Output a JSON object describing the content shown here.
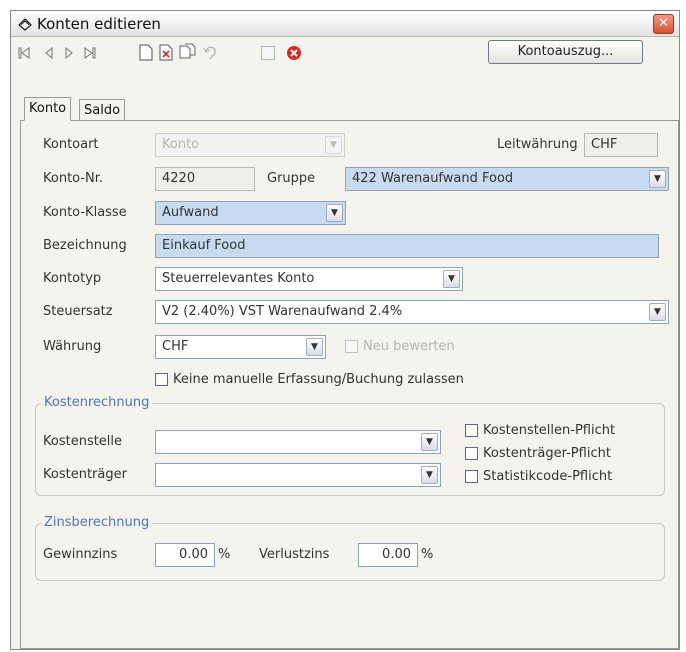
{
  "window": {
    "title": "Konten editieren",
    "close_glyph": "✕"
  },
  "toolbar": {
    "icons": [
      "first-record-icon",
      "previous-record-icon",
      "next-record-icon",
      "last-record-icon",
      "new-document-icon",
      "delete-document-icon",
      "copy-document-icon",
      "undo-icon",
      "checkbox-icon",
      "cancel-icon"
    ],
    "kontoauszug_label": "Kontoauszug..."
  },
  "tabs": [
    {
      "label": "Konto",
      "active": true
    },
    {
      "label": "Saldo",
      "active": false
    }
  ],
  "form": {
    "kontoart": {
      "label": "Kontoart",
      "value": "Konto"
    },
    "leitwaehrung": {
      "label": "Leitwährung",
      "value": "CHF"
    },
    "konto_nr": {
      "label": "Konto-Nr.",
      "value": "4220"
    },
    "gruppe": {
      "label": "Gruppe",
      "value": "422 Warenaufwand Food"
    },
    "konto_klasse": {
      "label": "Konto-Klasse",
      "value": "Aufwand"
    },
    "bezeichnung": {
      "label": "Bezeichnung",
      "value": "Einkauf Food"
    },
    "kontotyp": {
      "label": "Kontotyp",
      "value": "Steuerrelevantes Konto"
    },
    "steuersatz": {
      "label": "Steuersatz",
      "value": "V2 (2.40%) VST Warenaufwand 2.4%"
    },
    "waehrung": {
      "label": "Währung",
      "value": "CHF"
    },
    "neu_bewerten": {
      "label": "Neu bewerten",
      "checked": false,
      "disabled": true
    },
    "keine_manuelle": {
      "label": "Keine manuelle Erfassung/Buchung zulassen",
      "checked": false
    }
  },
  "kostenrechnung": {
    "title": "Kostenrechnung",
    "kostenstelle": {
      "label": "Kostenstelle",
      "value": ""
    },
    "kostentraeger": {
      "label": "Kostenträger",
      "value": ""
    },
    "checkboxes": [
      {
        "label": "Kostenstellen-Pflicht",
        "checked": false
      },
      {
        "label": "Kostenträger-Pflicht",
        "checked": false
      },
      {
        "label": "Statistikcode-Pflicht",
        "checked": false
      }
    ]
  },
  "zinsberechnung": {
    "title": "Zinsberechnung",
    "gewinnzins": {
      "label": "Gewinnzins",
      "value": "0.00",
      "unit": "%"
    },
    "verlustzins": {
      "label": "Verlustzins",
      "value": "0.00",
      "unit": "%"
    }
  },
  "colors": {
    "selected_field": "#c8daf0",
    "group_title": "#4f74b8",
    "cancel_icon": "#d12a2a",
    "close_button": "#d9532f"
  }
}
